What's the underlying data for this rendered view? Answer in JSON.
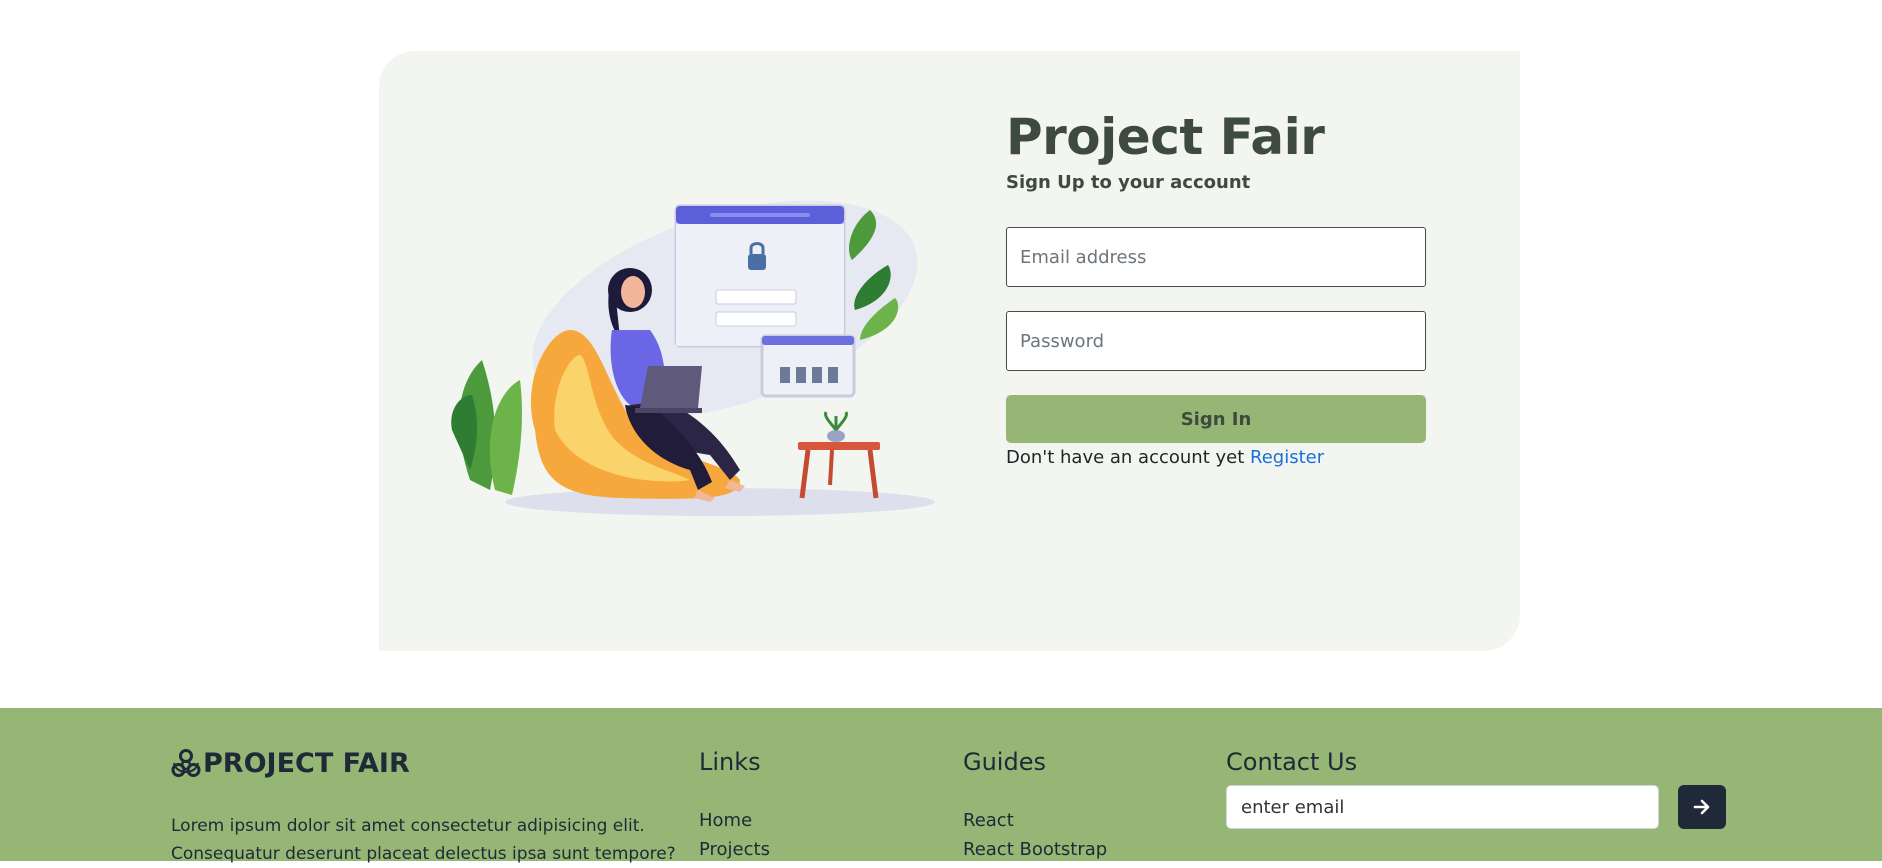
{
  "login": {
    "title": "Project Fair",
    "subtitle": "Sign Up to your account",
    "email_placeholder": "Email address",
    "password_placeholder": "Password",
    "signin_label": "Sign In",
    "register_prompt": "Don't have an account yet",
    "register_link": "Register"
  },
  "footer": {
    "brand": "PROJECT FAIR",
    "brand_icon": "biohazard-icon",
    "description": "Lorem ipsum dolor sit amet consectetur adipisicing elit. Consequatur deserunt placeat delectus ipsa sunt tempore?",
    "links_title": "Links",
    "links": [
      "Home",
      "Projects"
    ],
    "guides_title": "Guides",
    "guides": [
      "React",
      "React Bootstrap"
    ],
    "contact_title": "Contact Us",
    "contact_placeholder": "enter email",
    "send_icon": "arrow-right-icon"
  },
  "colors": {
    "accent_green": "#95b674",
    "card_bg": "#f3f6f0",
    "title_text": "#3e4a3d",
    "link_blue": "#1a6fd6",
    "dark": "#1f2937"
  }
}
